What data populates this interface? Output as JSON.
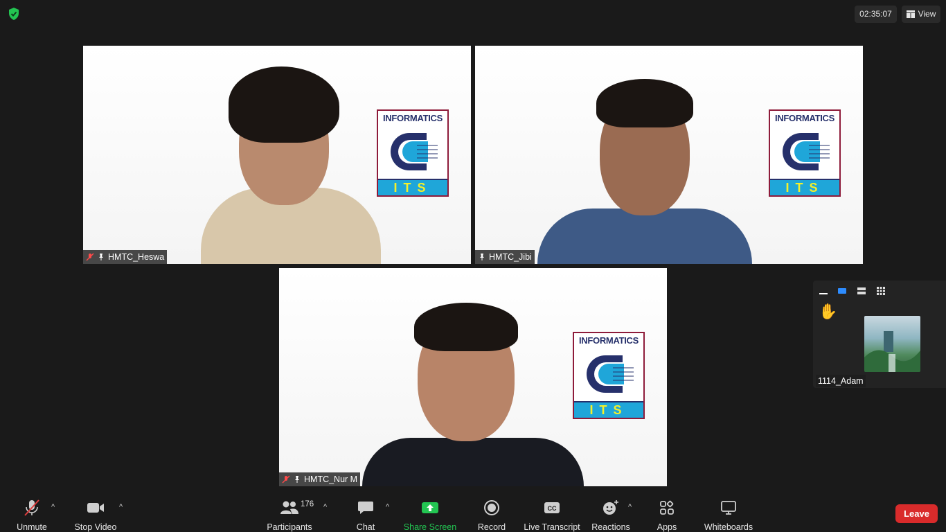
{
  "topbar": {
    "timer": "02:35:07",
    "view_label": "View"
  },
  "participants": [
    {
      "name": "HMTC_Heswa",
      "muted": true
    },
    {
      "name": "HMTC_Jibi",
      "muted": false
    },
    {
      "name": "HMTC_Nur M",
      "muted": true
    }
  ],
  "logo": {
    "text": "INFORMATICS",
    "badge": "ITS"
  },
  "side_panel": {
    "raised_hand": "✋",
    "participant_name": "1114_Adam"
  },
  "toolbar": {
    "unmute": "Unmute",
    "stop_video": "Stop Video",
    "participants": "Participants",
    "participants_count": "176",
    "chat": "Chat",
    "share_screen": "Share Screen",
    "record": "Record",
    "live_transcript": "Live Transcript",
    "reactions": "Reactions",
    "apps": "Apps",
    "whiteboards": "Whiteboards",
    "leave": "Leave",
    "cc_text": "CC"
  },
  "colors": {
    "background": "#1a1a1a",
    "share_green": "#23c552",
    "leave_red": "#d92b2b",
    "logo_border": "#8e1b3a",
    "logo_blue": "#1fa6d9"
  }
}
